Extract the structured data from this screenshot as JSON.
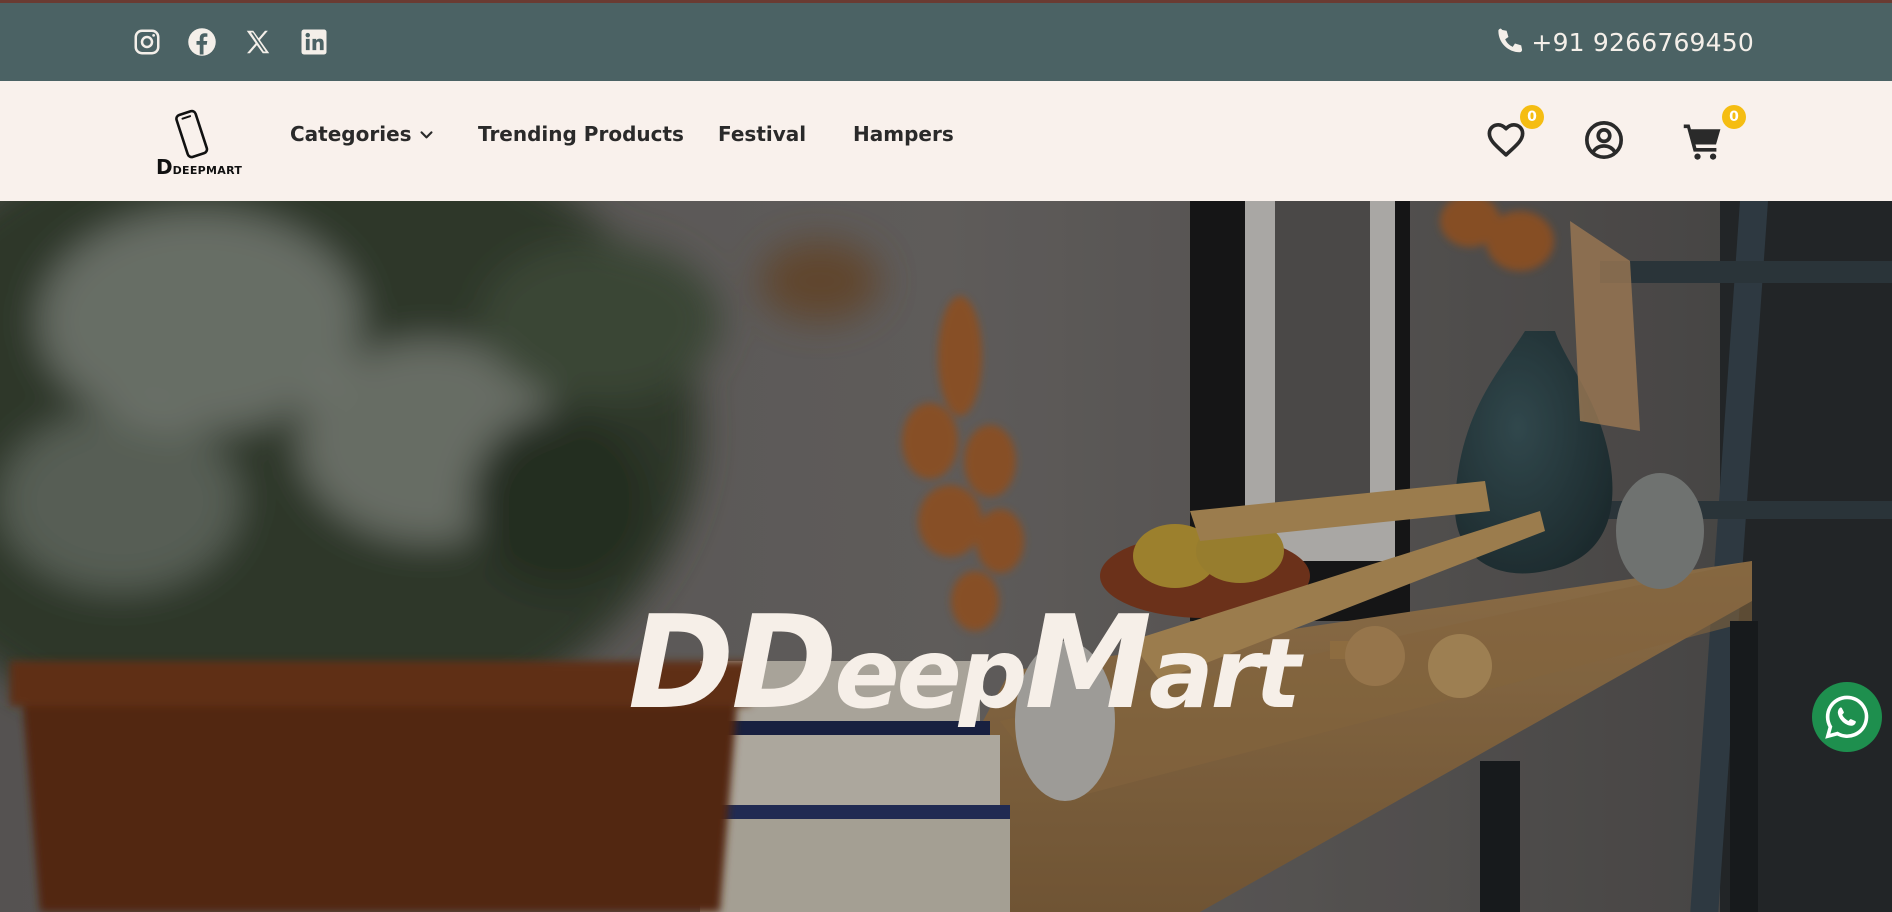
{
  "topbar": {
    "social": [
      {
        "icon": "instagram-icon",
        "label": "Instagram"
      },
      {
        "icon": "facebook-icon",
        "label": "Facebook"
      },
      {
        "icon": "x-icon",
        "label": "X"
      },
      {
        "icon": "linkedin-icon",
        "label": "LinkedIn"
      }
    ],
    "phone_icon": "phone-icon",
    "phone": "+91 9266769450"
  },
  "navbar": {
    "logo": {
      "big": "D",
      "small": "DEEPMART"
    },
    "links": {
      "categories": "Categories",
      "trending": "Trending Products",
      "festival": "Festival",
      "hampers": "Hampers"
    },
    "wishlist_count": "0",
    "cart_count": "0"
  },
  "hero": {
    "title_parts": [
      "DD",
      "eep",
      "M",
      "art"
    ]
  },
  "colors": {
    "topbar": "#4b6264",
    "navbar": "#f9f1ec",
    "badge": "#f5bd12",
    "whatsapp": "#1e8f4e"
  }
}
